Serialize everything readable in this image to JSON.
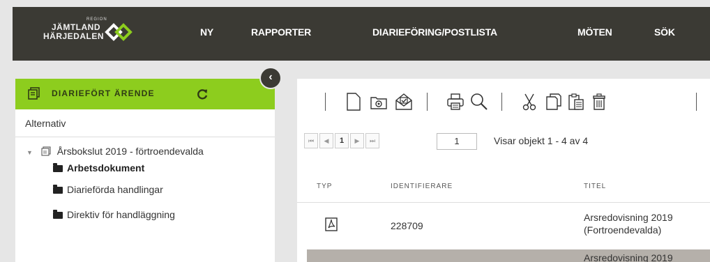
{
  "logo": {
    "region": "REGION",
    "line1": "JÄMTLAND",
    "line2": "HÄRJEDALEN"
  },
  "nav": [
    "NY",
    "RAPPORTER",
    "DIARIEFÖRING/POSTLISTA",
    "MÖTEN",
    "SÖK"
  ],
  "sidebar": {
    "title": "DIARIEFÖRT ÄRENDE",
    "alternativ": "Alternativ",
    "tree": {
      "root": "Årsbokslut 2019 - förtroendevalda",
      "children": [
        "Arbetsdokument",
        "Diarieförda handlingar",
        "Direktiv för handläggning"
      ]
    }
  },
  "pager": {
    "page": "1",
    "page_input": "1",
    "info": "Visar objekt 1 - 4 av 4"
  },
  "table": {
    "columns": [
      "TYP",
      "IDENTIFIERARE",
      "TITEL"
    ],
    "rows": [
      {
        "id": "228709",
        "title_line1": "Arsredovisning 2019",
        "title_line2": "(Fortroendevalda)"
      },
      {
        "id": "",
        "title_line1": "Arsredovisning 2019"
      }
    ]
  },
  "colors": {
    "topbar": "#3b3a34",
    "accent": "#8dcd1e",
    "background": "#e6e6e6"
  }
}
